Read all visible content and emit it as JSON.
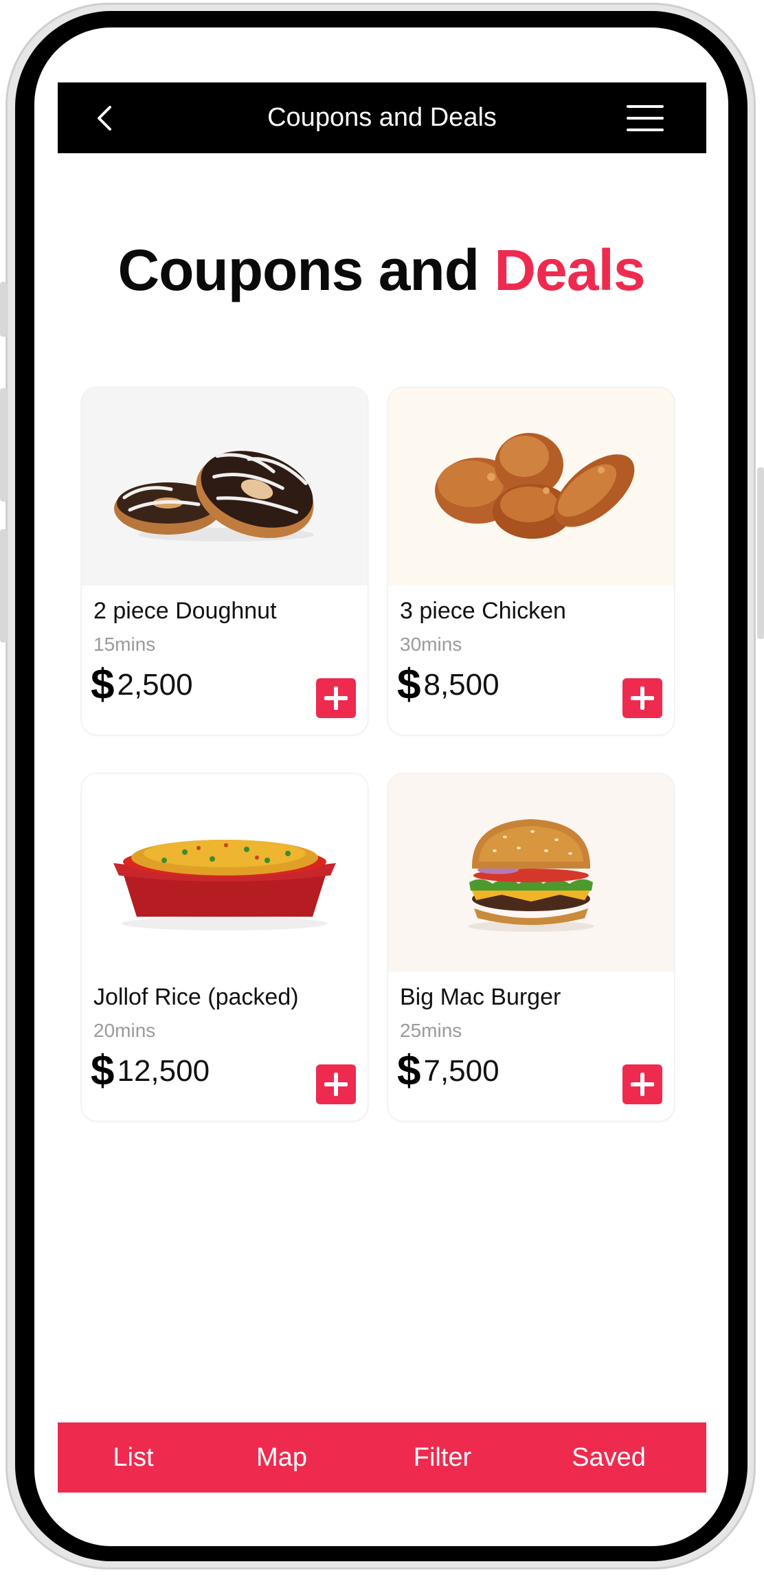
{
  "header": {
    "title": "Coupons and Deals",
    "back_icon": "chevron-left-icon",
    "menu_icon": "hamburger-menu-icon"
  },
  "heading": {
    "main": "Coupons and ",
    "accent": "Deals"
  },
  "colors": {
    "accent": "#ef2a4f",
    "header_bg": "#000000",
    "nav_bg": "#ef2a4f"
  },
  "products": [
    {
      "name": "2 piece Doughnut",
      "time": "15mins",
      "currency": "$",
      "price": "2,500",
      "image": "doughnut-image",
      "add_icon": "plus-icon"
    },
    {
      "name": "3 piece Chicken",
      "time": "30mins",
      "currency": "$",
      "price": "8,500",
      "image": "fried-chicken-image",
      "add_icon": "plus-icon"
    },
    {
      "name": "Jollof Rice (packed)",
      "time": "20mins",
      "currency": "$",
      "price": "12,500",
      "image": "jollof-rice-image",
      "add_icon": "plus-icon"
    },
    {
      "name": "Big Mac Burger",
      "time": "25mins",
      "currency": "$",
      "price": "7,500",
      "image": "burger-image",
      "add_icon": "plus-icon"
    }
  ],
  "bottom_nav": {
    "items": [
      {
        "label": "List"
      },
      {
        "label": "Map"
      },
      {
        "label": "Filter"
      },
      {
        "label": "Saved"
      }
    ]
  }
}
